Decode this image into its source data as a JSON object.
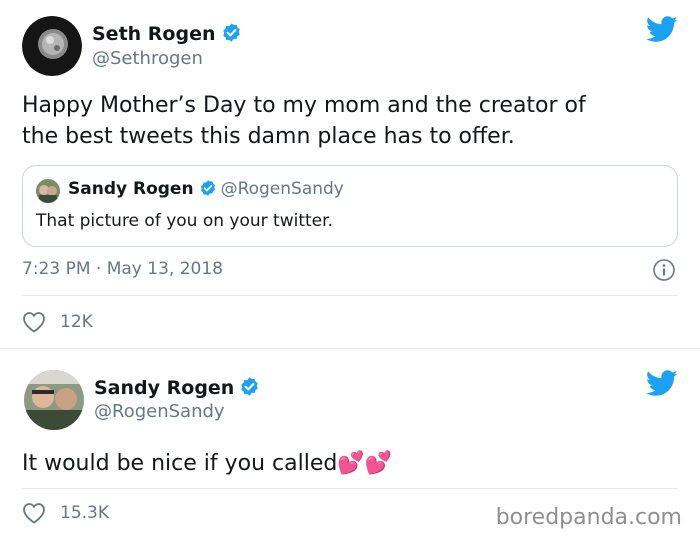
{
  "tweet1": {
    "name": "Seth Rogen",
    "handle": "@Sethrogen",
    "text_line1": "Happy Mother’s Day to my mom and the creator of",
    "text_line2": "the best tweets this damn place has to offer.",
    "quote": {
      "name": "Sandy Rogen",
      "handle": "@RogenSandy",
      "text": "That picture of you on your twitter."
    },
    "timestamp": "7:23 PM · May 13, 2018",
    "likes": "12K"
  },
  "tweet2": {
    "name": "Sandy Rogen",
    "handle": "@RogenSandy",
    "text": "It would be nice if you called",
    "emoji": "💕💕",
    "likes": "15.3K"
  },
  "watermark": "boredpanda.com",
  "colors": {
    "twitter_blue": "#1da1f2",
    "text": "#14171a",
    "muted": "#657786",
    "border": "#e6ecf0"
  },
  "icons": [
    "verified-badge-icon",
    "twitter-bird-icon",
    "info-icon",
    "heart-icon"
  ]
}
